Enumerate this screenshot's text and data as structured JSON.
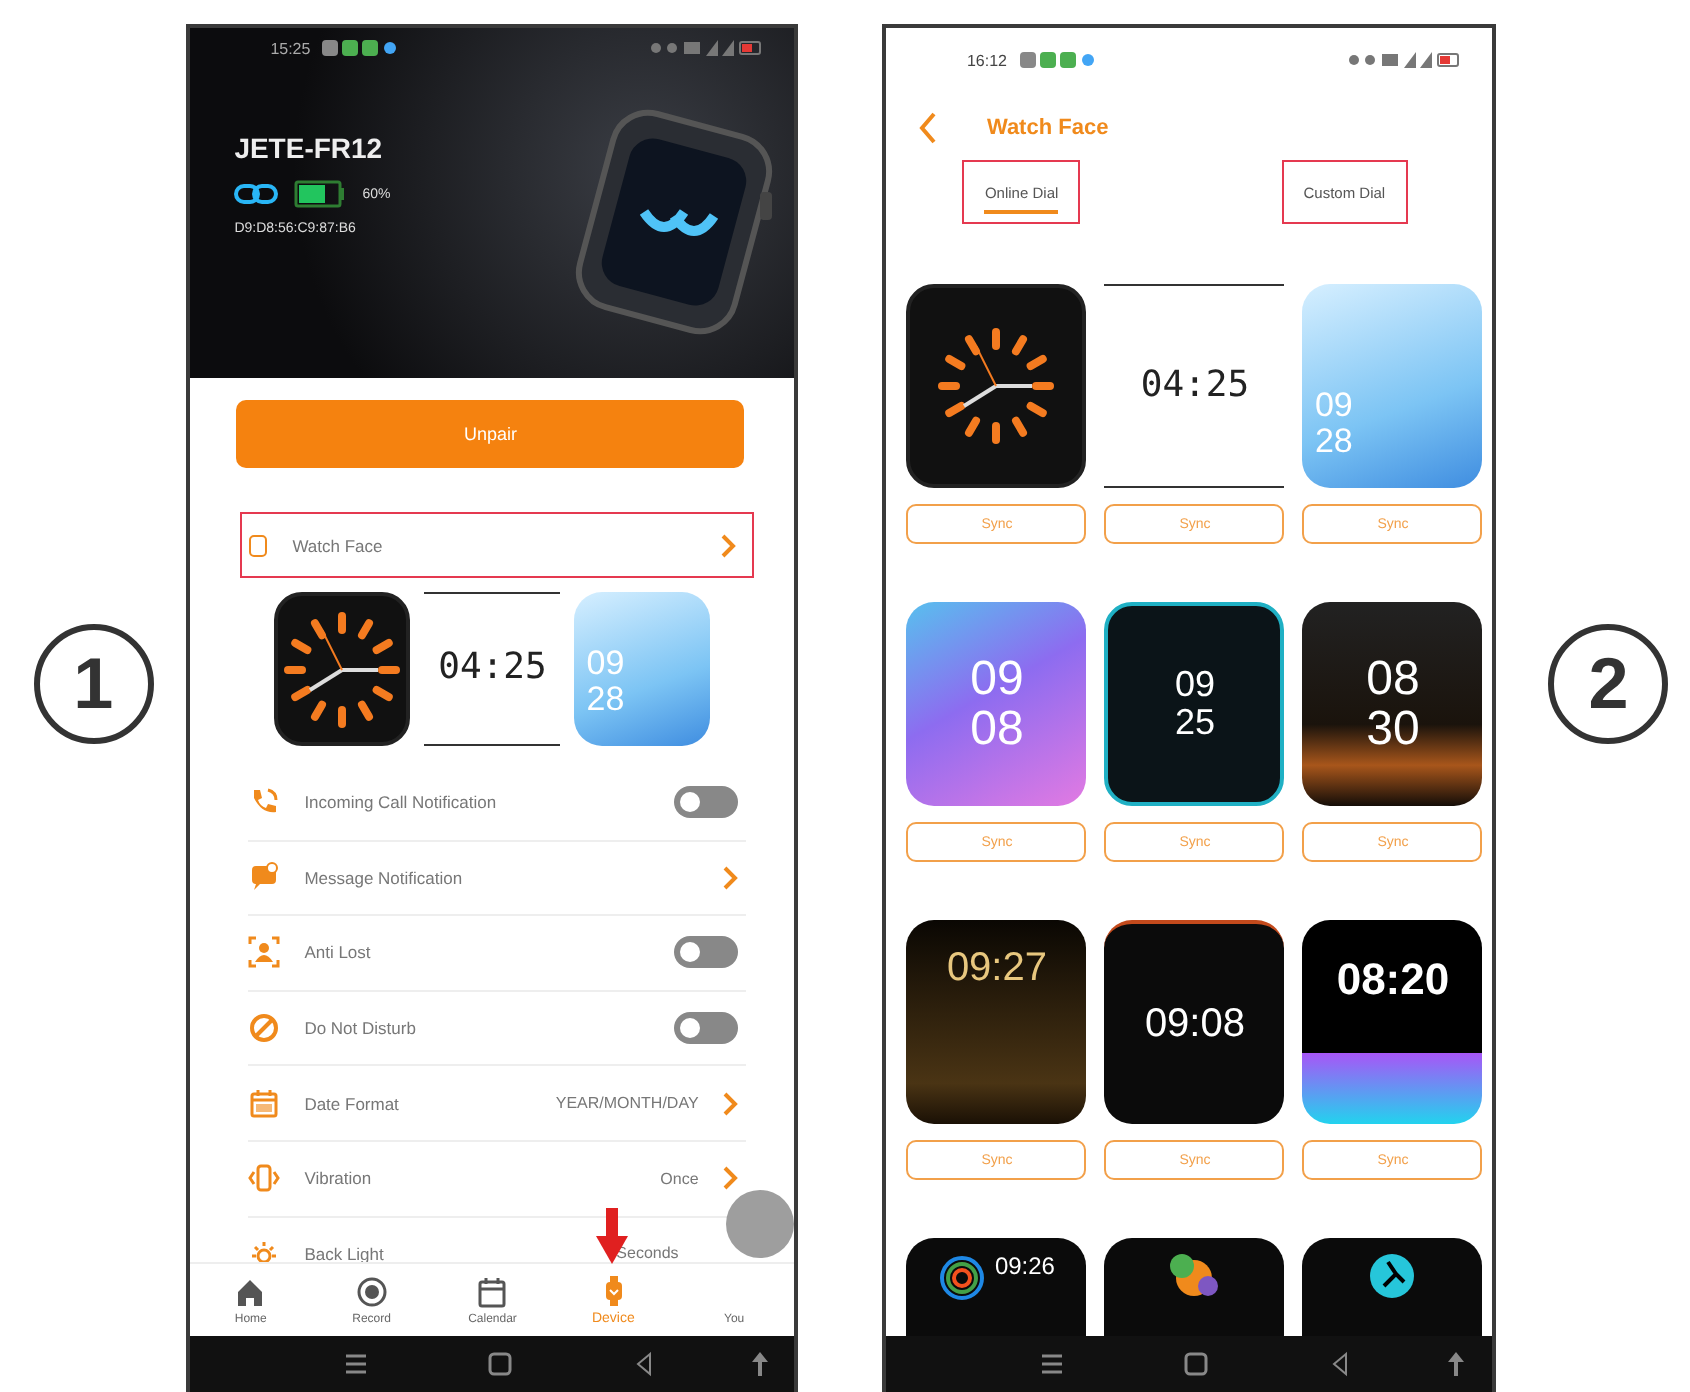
{
  "markers": [
    {
      "label": "1"
    },
    {
      "label": "2"
    }
  ],
  "device_screen": {
    "status_time": "15:25",
    "device_name": "JETE-FR12",
    "battery_text": "60%",
    "mac": "D9:D8:56:C9:87:B6",
    "unpair_button": "Unpair",
    "watch_face_row": {
      "label": "Watch Face",
      "highlighted": true
    },
    "preview_faces": [
      {
        "kind": "analog"
      },
      {
        "kind": "lcd",
        "time": "04:25"
      },
      {
        "kind": "blue",
        "time": "09 28"
      }
    ],
    "settings": [
      {
        "label": "Incoming Call Notification",
        "kind": "toggle",
        "on": false
      },
      {
        "label": "Message Notification",
        "kind": "link"
      },
      {
        "label": "Anti Lost",
        "kind": "toggle",
        "on": false
      },
      {
        "label": "Do Not Disturb",
        "kind": "toggle",
        "on": false
      },
      {
        "label": "Date Format",
        "kind": "link",
        "value": "YEAR/MONTH/DAY"
      },
      {
        "label": "Vibration",
        "kind": "link",
        "value": "Once"
      },
      {
        "label": "Back Light",
        "kind": "value",
        "value": "Seconds"
      }
    ],
    "bottom_nav": [
      {
        "label": "Home",
        "selected": false
      },
      {
        "label": "Record",
        "selected": false
      },
      {
        "label": "Calendar",
        "selected": false
      },
      {
        "label": "Device",
        "selected": true
      },
      {
        "label": "You",
        "selected": false
      }
    ]
  },
  "watch_face_screen": {
    "status_time": "16:12",
    "title": "Watch Face",
    "tabs": [
      {
        "label": "Online Dial",
        "selected": true,
        "highlighted": true
      },
      {
        "label": "Custom Dial",
        "selected": false,
        "highlighted": true
      }
    ],
    "faces": [
      {
        "kind": "analog",
        "button": "Sync"
      },
      {
        "kind": "lcd",
        "time": "04:25",
        "button": "Sync"
      },
      {
        "kind": "blue",
        "time": "09 28",
        "button": "Sync"
      },
      {
        "kind": "purple",
        "time": "09 08",
        "button": "Sync"
      },
      {
        "kind": "teal",
        "time": "09 25",
        "button": "Sync"
      },
      {
        "kind": "gold",
        "time": "08 30",
        "button": "Sync"
      },
      {
        "kind": "tree",
        "time": "09:27",
        "button": "Sync"
      },
      {
        "kind": "sport",
        "time": "09:08",
        "button": "Sync"
      },
      {
        "kind": "fitness",
        "time": "08:20",
        "button": "Sync"
      },
      {
        "kind": "ring",
        "time": "09:26"
      },
      {
        "kind": "cartoon"
      },
      {
        "kind": "runner"
      }
    ]
  }
}
